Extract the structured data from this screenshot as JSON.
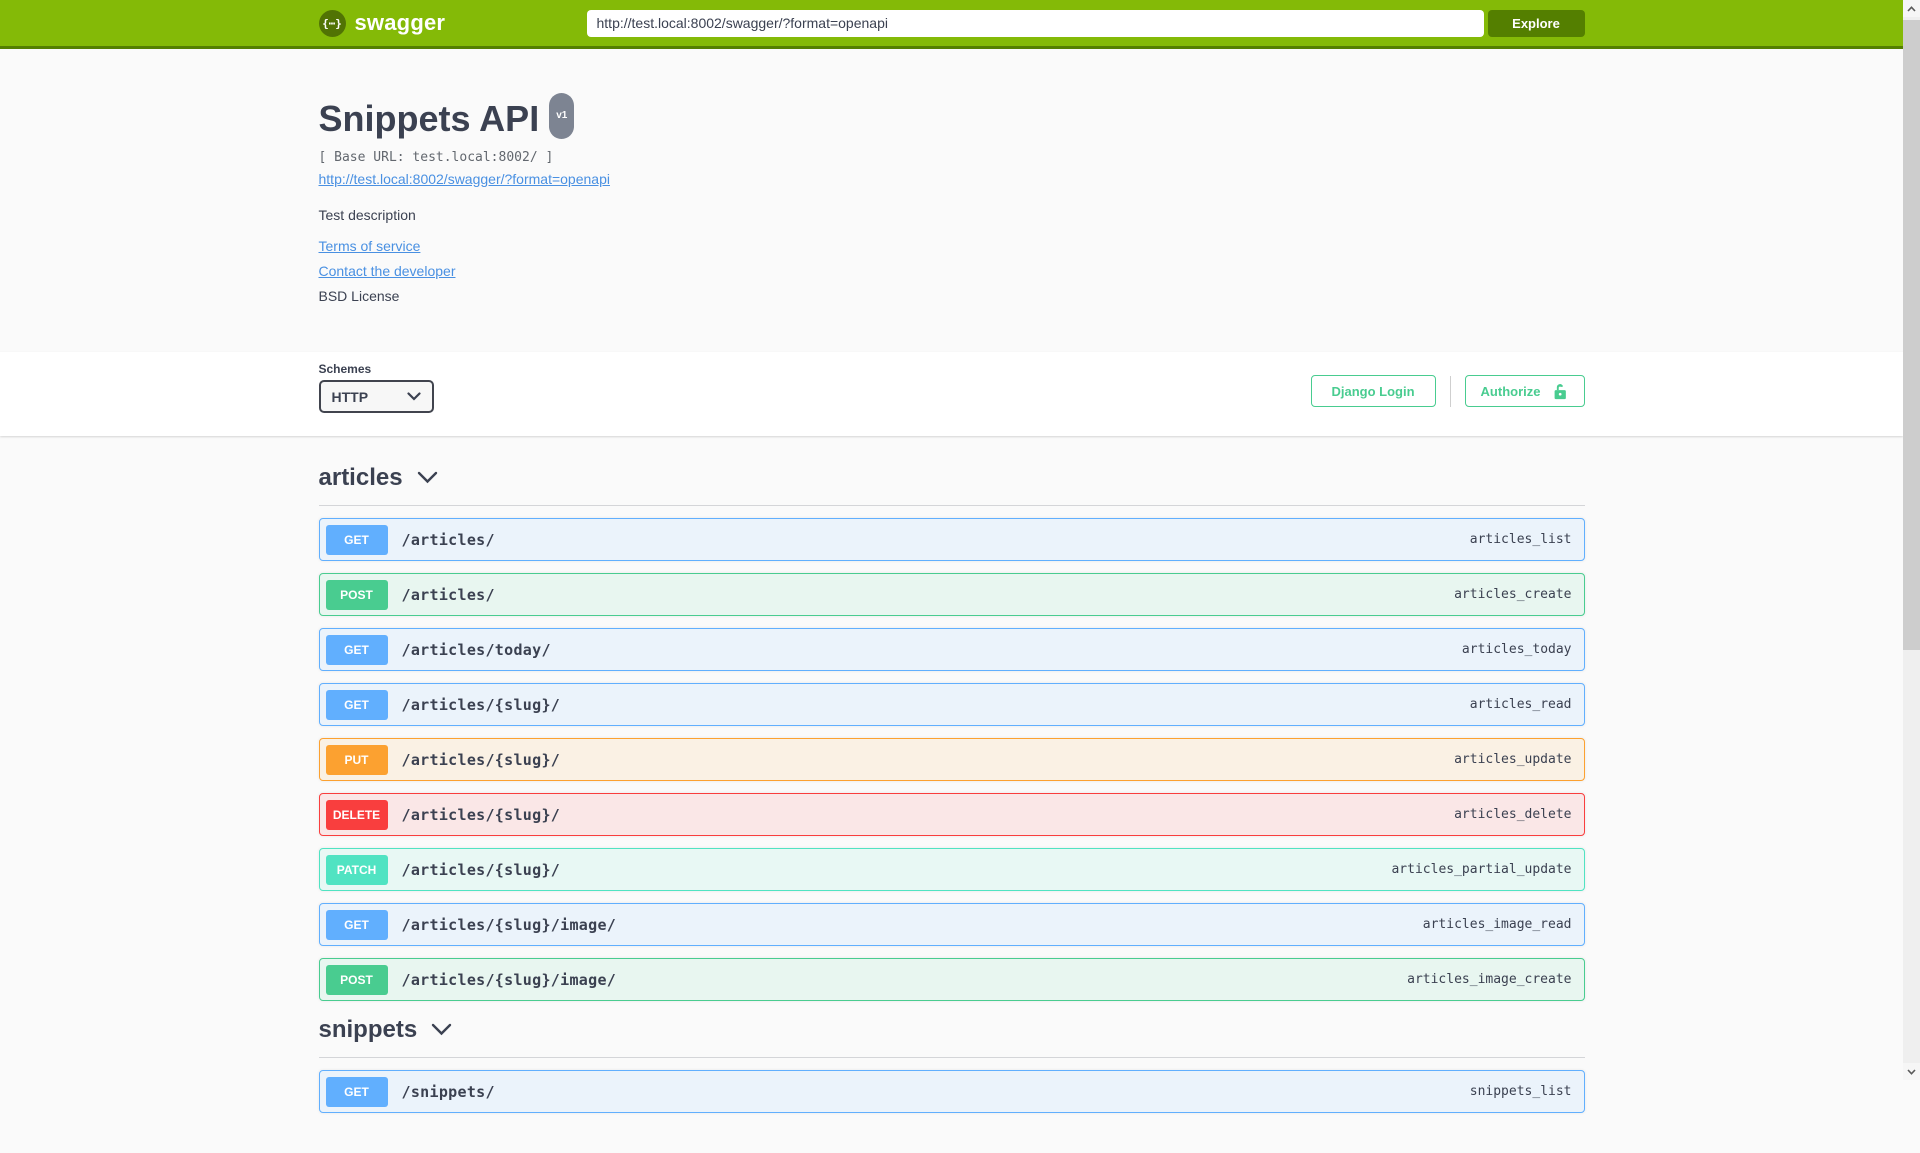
{
  "topbar": {
    "brand": "swagger",
    "logo_glyph": "{⋯}",
    "url_value": "http://test.local:8002/swagger/?format=openapi",
    "explore_label": "Explore"
  },
  "info": {
    "title": "Snippets API",
    "version": "v1",
    "base_url": "[ Base URL: test.local:8002/ ]",
    "spec_link": "http://test.local:8002/swagger/?format=openapi",
    "description": "Test description",
    "terms": "Terms of service",
    "contact": "Contact the developer",
    "license": "BSD License"
  },
  "scheme": {
    "label": "Schemes",
    "selected": "HTTP"
  },
  "auth": {
    "django_login_label": "Django Login",
    "authorize_label": "Authorize"
  },
  "colors": {
    "topbar_green": "#84ba07",
    "explore_green": "#547f00",
    "link_blue": "#4990e2",
    "auth_green": "#49cc90",
    "version_badge_gray": "#7d8492",
    "method_get": "#61affe",
    "method_post": "#49cc90",
    "method_put": "#fca130",
    "method_delete": "#f93e3e",
    "method_patch": "#50e3c2"
  },
  "sections": [
    {
      "name": "articles",
      "operations": [
        {
          "method": "GET",
          "path": "/articles/",
          "op_id": "articles_list"
        },
        {
          "method": "POST",
          "path": "/articles/",
          "op_id": "articles_create"
        },
        {
          "method": "GET",
          "path": "/articles/today/",
          "op_id": "articles_today"
        },
        {
          "method": "GET",
          "path": "/articles/{slug}/",
          "op_id": "articles_read"
        },
        {
          "method": "PUT",
          "path": "/articles/{slug}/",
          "op_id": "articles_update"
        },
        {
          "method": "DELETE",
          "path": "/articles/{slug}/",
          "op_id": "articles_delete"
        },
        {
          "method": "PATCH",
          "path": "/articles/{slug}/",
          "op_id": "articles_partial_update"
        },
        {
          "method": "GET",
          "path": "/articles/{slug}/image/",
          "op_id": "articles_image_read"
        },
        {
          "method": "POST",
          "path": "/articles/{slug}/image/",
          "op_id": "articles_image_create"
        }
      ]
    },
    {
      "name": "snippets",
      "operations": [
        {
          "method": "GET",
          "path": "/snippets/",
          "op_id": "snippets_list"
        }
      ]
    }
  ]
}
